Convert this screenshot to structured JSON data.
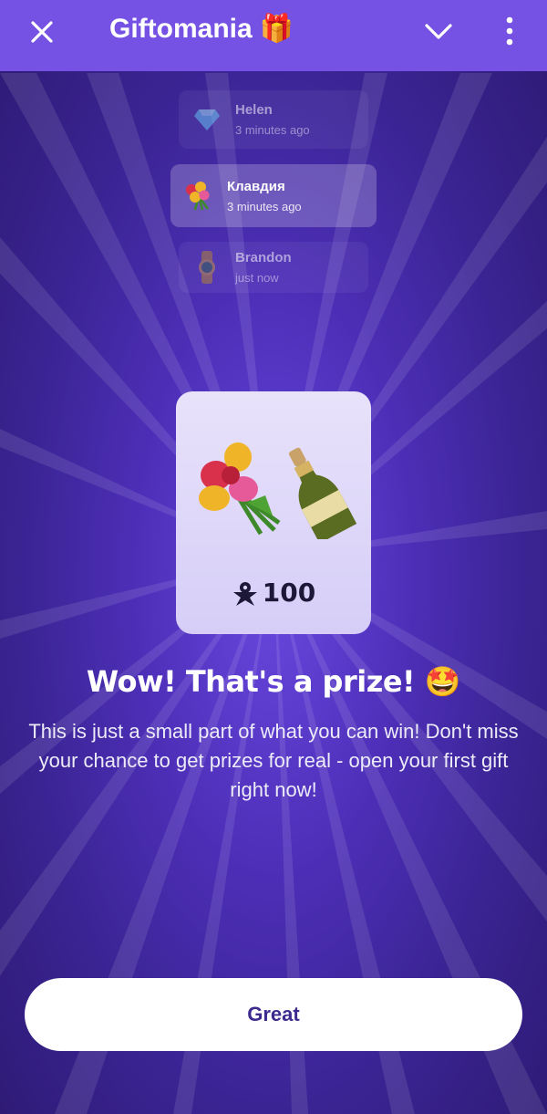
{
  "header": {
    "title": "Giftomania",
    "title_emoji": "🎁",
    "close_icon": "close-icon",
    "collapse_icon": "chevron-down-icon",
    "menu_icon": "more-vertical-icon"
  },
  "feed": [
    {
      "name": "Helen",
      "time": "3 minutes ago",
      "gift": "diamond"
    },
    {
      "name": "Клавдия",
      "time": "3 minutes ago",
      "gift": "flowers"
    },
    {
      "name": "Brandon",
      "time": "just now",
      "gift": "watch"
    }
  ],
  "prize": {
    "items": [
      "flowers",
      "champagne"
    ],
    "amount": "100",
    "currency_icon": "star-coin-icon"
  },
  "headline": "Wow! That's a prize! 🤩",
  "description": "This is just a small part of what you can win! Don't miss your chance to get prizes for real - open your first gift right now!",
  "button": {
    "label": "Great"
  },
  "colors": {
    "header": "#7552e3",
    "background": "#4d2fb8",
    "button_text": "#3d2a8f"
  }
}
